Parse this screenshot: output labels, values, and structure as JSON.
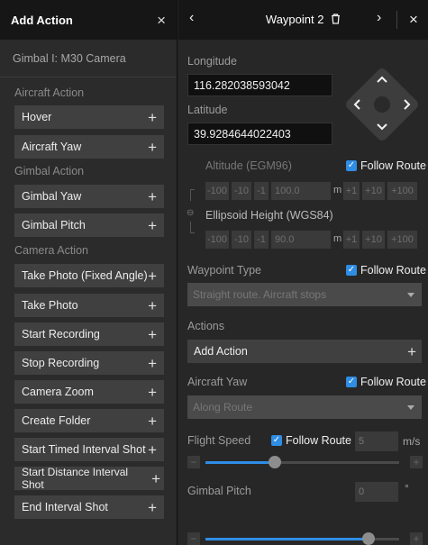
{
  "left_panel": {
    "title": "Add Action",
    "close_icon": "×",
    "gimbal_label": "Gimbal I: M30 Camera",
    "sections": {
      "aircraft": "Aircraft Action",
      "gimbal": "Gimbal Action",
      "camera": "Camera Action"
    },
    "items": [
      {
        "label": "Hover"
      },
      {
        "label": "Aircraft Yaw"
      },
      {
        "label": "Gimbal Yaw"
      },
      {
        "label": "Gimbal Pitch"
      },
      {
        "label": "Take Photo (Fixed Angle)"
      },
      {
        "label": "Take Photo"
      },
      {
        "label": "Start Recording"
      },
      {
        "label": "Stop Recording"
      },
      {
        "label": "Camera Zoom"
      },
      {
        "label": "Create Folder"
      },
      {
        "label": "Start Timed Interval Shot"
      },
      {
        "label": "Start Distance Interval Shot"
      },
      {
        "label": "End Interval Shot"
      }
    ],
    "plus_glyph": "+"
  },
  "right_panel": {
    "prev_glyph": "‹",
    "next_glyph": "›",
    "close_glyph": "×",
    "title": "Waypoint 2",
    "delete_icon": "trash-icon",
    "longitude_label": "Longitude",
    "longitude_value": "116.282038593042",
    "latitude_label": "Latitude",
    "latitude_value": "39.9284644022403",
    "altitude_label": "Altitude (EGM96)",
    "follow_route": "Follow Route",
    "altitude_steps": [
      "-100",
      "-10",
      "-1",
      "100.0",
      "m",
      "+1",
      "+10",
      "+100"
    ],
    "ellipsoid_label": "Ellipsoid Height (WGS84)",
    "ellipsoid_steps": [
      "-100",
      "-10",
      "-1",
      "90.0",
      "m",
      "+1",
      "+10",
      "+100"
    ],
    "waypoint_type_label": "Waypoint Type",
    "waypoint_type_value": "Straight route. Aircraft stops",
    "actions_label": "Actions",
    "add_action_label": "Add Action",
    "aircraft_yaw_label": "Aircraft Yaw",
    "aircraft_yaw_value": "Along Route",
    "flight_speed_label": "Flight Speed",
    "flight_speed_value": "5",
    "flight_speed_unit": "m/s",
    "flight_speed_fraction": 0.36,
    "gimbal_pitch_label": "Gimbal Pitch",
    "gimbal_pitch_value": "0",
    "gimbal_pitch_unit": "°",
    "gimbal_pitch_fraction": 0.84
  },
  "colors": {
    "accent": "#2f8de4",
    "panel_bg": "#2b2b2b",
    "header_bg": "#161616"
  }
}
